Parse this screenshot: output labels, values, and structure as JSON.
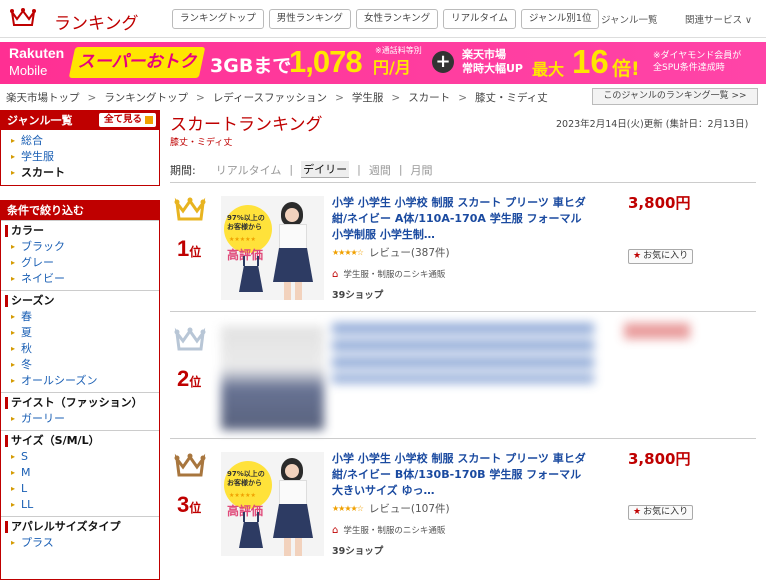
{
  "header": {
    "brand": "ランキング",
    "nav": [
      "ランキングトップ",
      "男性ランキング",
      "女性ランキング",
      "リアルタイム",
      "ジャンル別1位"
    ],
    "genre_list": "ジャンル一覧",
    "related_services": "関連サービス ∨",
    "accent_color": "#bf0000"
  },
  "banner": {
    "rakuten": "Rakuten",
    "mobile": "Mobile",
    "super": "スーパーおトク",
    "gb": "3GBまで",
    "price": "1,078",
    "unit": "円/月",
    "note": "※通話料等別",
    "plus": "+",
    "ichiba_line1": "楽天市場",
    "ichiba_line2": "常時大幅UP",
    "max": "最大",
    "sixteen": "16",
    "bai": "倍!",
    "dia_line1": "※ダイヤモンド会員が",
    "dia_line2": "全SPU条件達成時"
  },
  "breadcrumb": [
    "楽天市場トップ",
    "ランキングトップ",
    "レディースファッション",
    "学生服",
    "スカート",
    "膝丈・ミディ丈"
  ],
  "breadcrumb_sep": ">",
  "genre_ranking_list_btn": "このジャンルのランキング一覧 >>",
  "sidebar": {
    "genre_title": "ジャンル一覧",
    "see_all": "全て見る",
    "genre_items": [
      "総合",
      "学生服",
      "スカート"
    ],
    "filter_title": "条件で絞り込む",
    "groups": [
      {
        "title": "カラー",
        "items": [
          "ブラック",
          "グレー",
          "ネイビー"
        ]
      },
      {
        "title": "シーズン",
        "items": [
          "春",
          "夏",
          "秋",
          "冬",
          "オールシーズン"
        ]
      },
      {
        "title": "テイスト（ファッション）",
        "items": [
          "ガーリー"
        ]
      },
      {
        "title": "サイズ（S/M/L）",
        "items": [
          "S",
          "M",
          "L",
          "LL"
        ]
      },
      {
        "title": "アパレルサイズタイプ",
        "items": [
          "プラス"
        ]
      }
    ]
  },
  "main": {
    "title": "スカートランキング",
    "subtitle": "膝丈・ミディ丈",
    "date": "2023年2月14日(火)更新 (集計日：2月13日)",
    "period_label": "期間:",
    "periods": [
      "リアルタイム",
      "デイリー",
      "週間",
      "月間"
    ],
    "active_period": "デイリー"
  },
  "items": [
    {
      "rank": "1",
      "rank_suffix": "位",
      "crown_color": "#e8b420",
      "title": "小学 小学生 小学校 制服 スカート プリーツ 車ヒダ 紺/ネイビー A体/110A-170A 学生服 フォーマル 小学制服 小学生制…",
      "rating_stars": "★★★★☆",
      "reviews": "レビュー(387件)",
      "shop": "学生服・制服のニシキ通販",
      "shop_logo": "39ショップ",
      "price": "3,800円",
      "fav": "お気に入り",
      "badge_line1": "97%以上の",
      "badge_line2": "お客様から",
      "badge_hyoka": "高評価"
    },
    {
      "rank": "2",
      "rank_suffix": "位",
      "crown_color": "#b8c6d6"
    },
    {
      "rank": "3",
      "rank_suffix": "位",
      "crown_color": "#a8763e",
      "title": "小学 小学生 小学校 制服 スカート プリーツ 車ヒダ 紺/ネイビー B体/130B-170B 学生服 フォーマル 大きいサイズ ゆっ…",
      "rating_stars": "★★★★☆",
      "reviews": "レビュー(107件)",
      "shop": "学生服・制服のニシキ通販",
      "shop_logo": "39ショップ",
      "price": "3,800円",
      "fav": "お気に入り",
      "badge_line1": "97%以上の",
      "badge_line2": "お客様から",
      "badge_hyoka": "高評価"
    }
  ]
}
